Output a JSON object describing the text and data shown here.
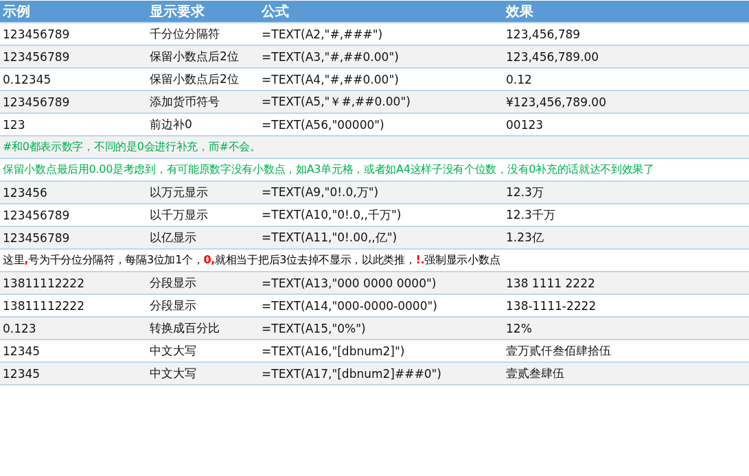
{
  "table": {
    "columns": [
      "示例",
      "显示要求",
      "公式",
      "效果"
    ],
    "rows": [
      {
        "kind": "data",
        "cells": [
          "123456789",
          "千分位分隔符",
          "=TEXT(A2,\"#,###\")",
          "123,456,789"
        ]
      },
      {
        "kind": "data",
        "cells": [
          "123456789",
          "保留小数点后2位",
          "=TEXT(A3,\"#,##0.00\")",
          "123,456,789.00"
        ]
      },
      {
        "kind": "data",
        "cells": [
          "0.12345",
          "保留小数点后2位",
          "=TEXT(A4,\"#,##0.00\")",
          "0.12"
        ]
      },
      {
        "kind": "data",
        "cells": [
          "123456789",
          "添加货币符号",
          "=TEXT(A5,\"￥#,##0.00\")",
          "¥123,456,789.00"
        ]
      },
      {
        "kind": "data",
        "cells": [
          "123",
          "前边补0",
          "=TEXT(A56,\"00000\")",
          "00123"
        ]
      },
      {
        "kind": "note",
        "color": "#00b050",
        "segments": [
          {
            "text": "#和0都表示数字，不同的是0会进行补充，而#不会。",
            "highlight": false
          }
        ]
      },
      {
        "kind": "note",
        "color": "#00b050",
        "segments": [
          {
            "text": "保留小数点最后用0.00是考虑到，有可能原数字没有小数点，如A3单元格，或者如A4这样子没有个位数，没有0补充的话就达不到效果了",
            "highlight": false
          }
        ]
      },
      {
        "kind": "data",
        "cells": [
          "123456",
          "以万元显示",
          "=TEXT(A9,\"0!.0,万\")",
          "12.3万"
        ]
      },
      {
        "kind": "data",
        "cells": [
          "123456789",
          "以千万显示",
          "=TEXT(A10,\"0!.0,,千万\")",
          "12.3千万"
        ]
      },
      {
        "kind": "data",
        "cells": [
          "123456789",
          "以亿显示",
          "=TEXT(A11,\"0!.00,,亿\")",
          "1.23亿"
        ]
      },
      {
        "kind": "note",
        "color": "#000000",
        "segments": [
          {
            "text": "这里",
            "highlight": false
          },
          {
            "text": ",",
            "highlight": true
          },
          {
            "text": "号为千分位分隔符，每隔3位加1个，",
            "highlight": false
          },
          {
            "text": "0,",
            "highlight": true
          },
          {
            "text": "就相当于把后3位去掉不显示，以此类推，",
            "highlight": false
          },
          {
            "text": "!.",
            "highlight": true
          },
          {
            "text": "强制显示小数点",
            "highlight": false
          }
        ]
      },
      {
        "kind": "data",
        "cells": [
          "13811112222",
          "分段显示",
          "=TEXT(A13,\"000 0000 0000\")",
          "138 1111 2222"
        ]
      },
      {
        "kind": "data",
        "cells": [
          "13811112222",
          "分段显示",
          "=TEXT(A14,\"000-0000-0000\")",
          "138-1111-2222"
        ]
      },
      {
        "kind": "data",
        "cells": [
          "0.123",
          "转换成百分比",
          "=TEXT(A15,\"0%\")",
          "12%"
        ]
      },
      {
        "kind": "data",
        "cells": [
          "12345",
          "中文大写",
          "=TEXT(A16,\"[dbnum2]\")",
          "壹万贰仟叁佰肆拾伍"
        ]
      },
      {
        "kind": "data",
        "cells": [
          "12345",
          "中文大写",
          "=TEXT(A17,\"[dbnum2]###0\")",
          "壹贰叁肆伍"
        ]
      }
    ]
  }
}
